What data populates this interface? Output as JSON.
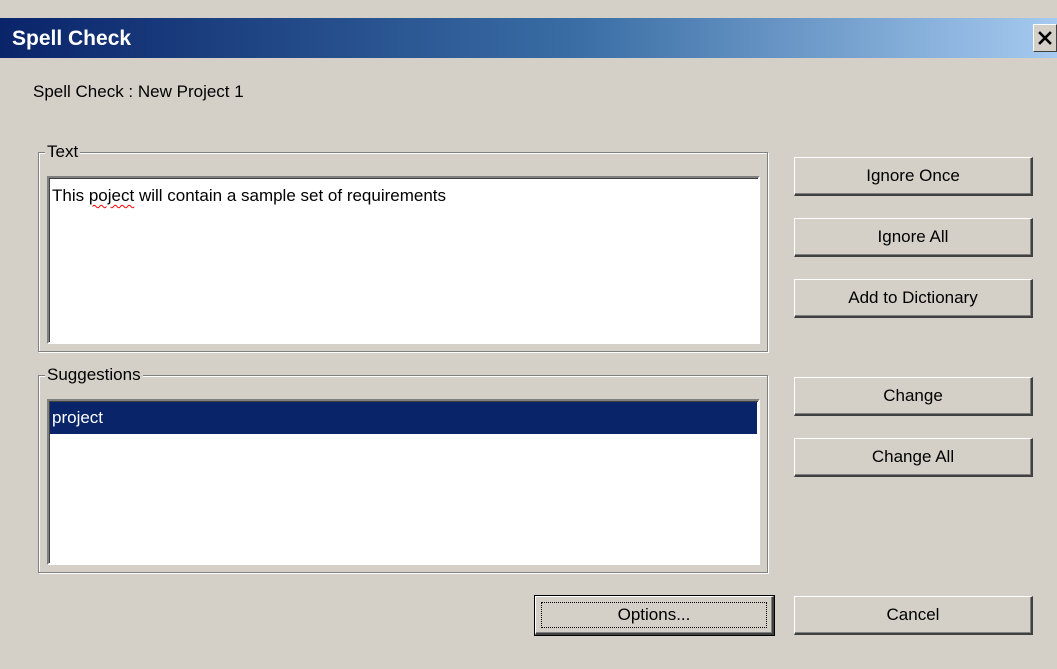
{
  "window": {
    "title": "Spell Check",
    "subtitle": "Spell Check : New Project 1"
  },
  "text_group": {
    "label": "Text",
    "before": "This ",
    "misspelled_word": "poject",
    "after": " will contain a sample set of requirements"
  },
  "suggestions_group": {
    "label": "Suggestions",
    "items": [
      "project"
    ],
    "selected": "project"
  },
  "buttons": {
    "ignore_once": "Ignore Once",
    "ignore_all": "Ignore All",
    "add_to_dictionary": "Add to Dictionary",
    "change": "Change",
    "change_all": "Change All",
    "options": "Options...",
    "cancel": "Cancel"
  },
  "colors": {
    "title_gradient_start": "#0a246a",
    "title_gradient_end": "#a6caf0",
    "selection": "#0a246a",
    "misspelled_underline": "#ff0000",
    "window_face": "#d4d0c8"
  },
  "icons": {
    "close": "close-icon"
  }
}
